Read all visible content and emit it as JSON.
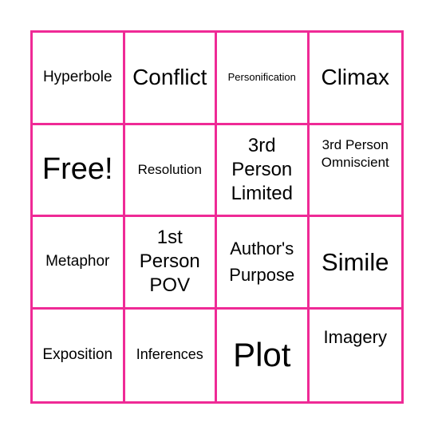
{
  "board": {
    "border_color": "#ef2a96",
    "cells": [
      {
        "text": "Hyperbole"
      },
      {
        "text": "Conflict"
      },
      {
        "text": "Personification"
      },
      {
        "text": "Climax"
      },
      {
        "text": "Free!"
      },
      {
        "text": "Resolution"
      },
      {
        "text": "3rd Person Limited"
      },
      {
        "text": "3rd Person Omniscient"
      },
      {
        "text": "Metaphor"
      },
      {
        "text": "1st Person POV"
      },
      {
        "text": "Author's Purpose"
      },
      {
        "text": "Simile"
      },
      {
        "text": "Exposition"
      },
      {
        "text": "Inferences"
      },
      {
        "text": "Plot"
      },
      {
        "text": "Imagery"
      }
    ]
  }
}
